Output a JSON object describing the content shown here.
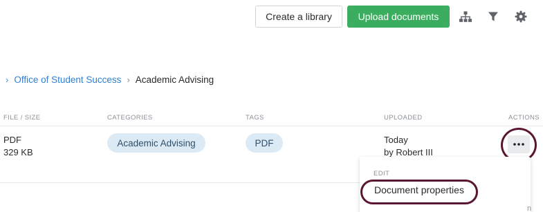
{
  "toolbar": {
    "create_label": "Create a library",
    "upload_label": "Upload documents",
    "accent_color": "#3aae5e",
    "icons": [
      "hierarchy-icon",
      "filter-icon",
      "gear-icon"
    ]
  },
  "breadcrumb": {
    "items": [
      {
        "label": "Office of Student Success"
      },
      {
        "label": "Academic Advising"
      }
    ]
  },
  "table": {
    "columns": [
      "FILE / SIZE",
      "CATEGORIES",
      "TAGS",
      "UPLOADED",
      "ACTIONS"
    ],
    "rows": [
      {
        "file_type": "PDF",
        "file_size": "329 KB",
        "category": "Academic Advising",
        "tag": "PDF",
        "uploaded_date": "Today",
        "uploaded_by": "by Robert III"
      }
    ]
  },
  "actions_menu": {
    "section": "EDIT",
    "items": [
      "Document properties"
    ],
    "highlight_color": "#5a1530"
  },
  "footer": {
    "corner_text": "n"
  }
}
